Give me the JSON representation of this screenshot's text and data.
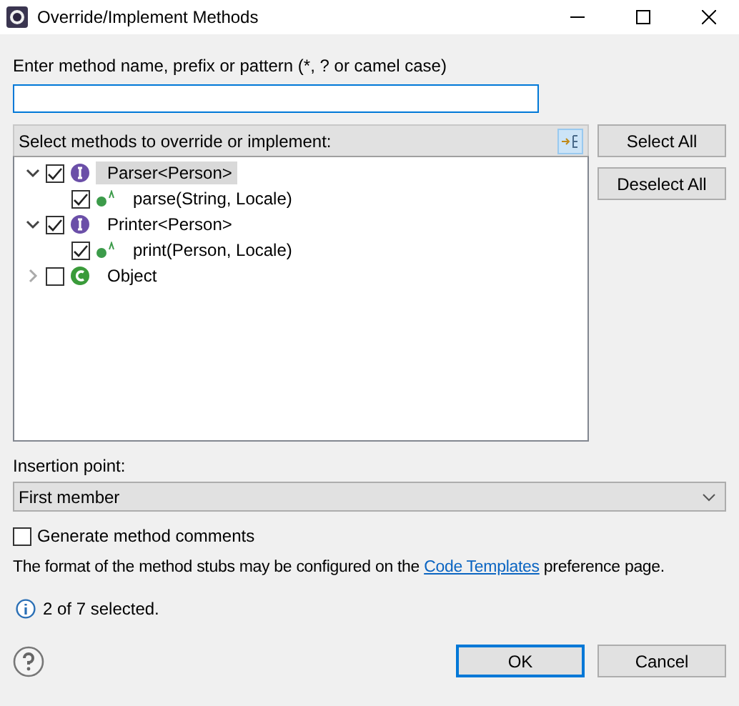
{
  "window": {
    "title": "Override/Implement Methods"
  },
  "filter": {
    "label": "Enter method name, prefix or pattern (*, ? or camel case)"
  },
  "tree": {
    "label": "Select methods to override or implement:",
    "items": [
      {
        "kind": "interface",
        "label": "Parser<Person>",
        "expanded": true,
        "checked": true,
        "selected": true,
        "children": [
          {
            "kind": "method",
            "label": "parse(String, Locale)",
            "checked": true,
            "selected": false
          }
        ]
      },
      {
        "kind": "interface",
        "label": "Printer<Person>",
        "expanded": true,
        "checked": true,
        "selected": false,
        "children": [
          {
            "kind": "method",
            "label": "print(Person, Locale)",
            "checked": true,
            "selected": false
          }
        ]
      },
      {
        "kind": "class",
        "label": "Object",
        "expanded": false,
        "checked": false,
        "selected": false
      }
    ]
  },
  "side_buttons": [
    "Select All",
    "Deselect All"
  ],
  "insertion": {
    "label": "Insertion point:",
    "value": "First member"
  },
  "generate_comments": {
    "label": "Generate method comments",
    "checked": false
  },
  "note": {
    "before": "The format of the method stubs may be configured on the ",
    "link": "Code Templates",
    "after": " preference page."
  },
  "status": "2 of 7 selected.",
  "buttons": [
    {
      "label": "OK",
      "default": true
    },
    {
      "label": "Cancel",
      "default": false
    }
  ]
}
